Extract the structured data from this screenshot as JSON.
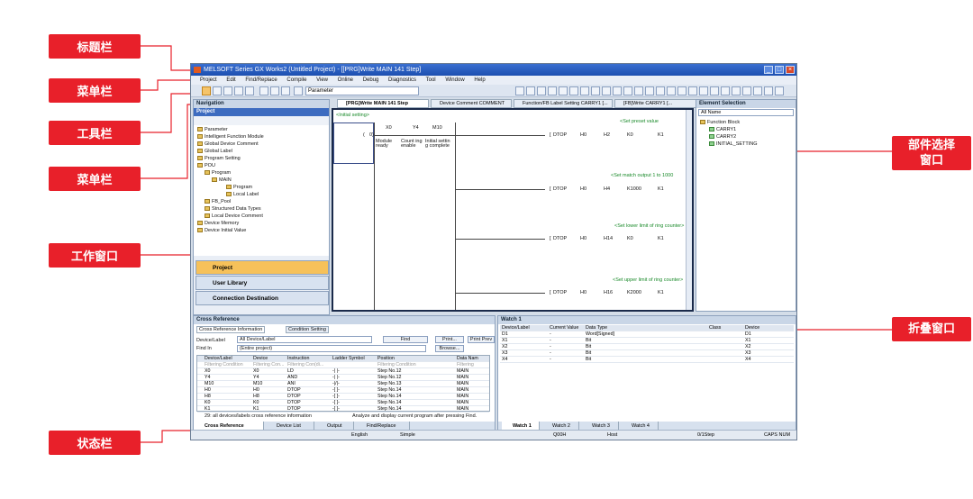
{
  "annotations": {
    "title_bar": "标题栏",
    "menu_bar_1": "菜单栏",
    "toolbar": "工具栏",
    "menu_bar_2": "菜单栏",
    "work_window": "工作窗口",
    "status_bar": "状态栏",
    "element_selection": "部件选择窗口",
    "collapse_window": "折叠窗口"
  },
  "window": {
    "title": "MELSOFT Series GX Works2 (Untitled Project) - [[PRG]Write MAIN 141 Step]",
    "menu": [
      "Project",
      "Edit",
      "Find/Replace",
      "Compile",
      "View",
      "Online",
      "Debug",
      "Diagnostics",
      "Tool",
      "Window",
      "Help"
    ],
    "toolbar_select": "Parameter"
  },
  "navigation": {
    "title": "Navigation",
    "sub_title": "Project",
    "tree": [
      "Parameter",
      "Intelligent Function Module",
      "Global Device Comment",
      "Global Label",
      "Program Setting",
      "POU",
      "Program",
      "MAIN",
      "Program",
      "Local Label",
      "FB_Pool",
      "Structured Data Types",
      "Local Device Comment",
      "Device Memory",
      "Device Initial Value"
    ],
    "buttons": [
      "Project",
      "User Library",
      "Connection Destination"
    ]
  },
  "tabs": [
    "[PRG]Write MAIN 141 Step",
    "Device Comment COMMENT",
    "Function/FB Label Setting CARRY1 [...",
    "[FB]Write CARRY1 [..."
  ],
  "ladder": {
    "header": "<Initial setting>",
    "contacts": [
      "X0",
      "Y4",
      "M10"
    ],
    "contact_comments": [
      "Module ready",
      "Count ing enable",
      "Initial settin g complete"
    ],
    "comments": [
      "<Set preset value",
      "<Set match output 1 to 1000",
      "<Set lower limit of ring counter>",
      "<Set upper limit of ring counter>"
    ],
    "rungs": [
      {
        "instr": "DTOP",
        "a": "H0",
        "b": "H2",
        "c": "K0",
        "d": "K1"
      },
      {
        "instr": "DTOP",
        "a": "H0",
        "b": "H4",
        "c": "K1000",
        "d": "K1"
      },
      {
        "instr": "DTOP",
        "a": "H0",
        "b": "H14",
        "c": "K0",
        "d": "K1"
      },
      {
        "instr": "DTOP",
        "a": "H0",
        "b": "H16",
        "c": "K2000",
        "d": "K1"
      }
    ]
  },
  "element_selection": {
    "title": "Element Selection",
    "select": "All Name",
    "tree": [
      "Function Block",
      "CARRY1",
      "CARRY2",
      "INITIAL_SETTING"
    ]
  },
  "cross_reference": {
    "title": "Cross Reference",
    "tab1": "Cross Reference Information",
    "tab2": "Condition Setting",
    "device_label": "Device/Label",
    "device_value": "All Device/Label",
    "find_in": "Find In",
    "find_value": "(Entire project)",
    "find_btn": "Find",
    "print_btn": "Print...",
    "print_prev": "Print Prev",
    "browse_btn": "Browse...",
    "columns": [
      "Device/Label",
      "Device",
      "Instruction",
      "Ladder Symbol",
      "Position",
      "Data Nam"
    ],
    "filter": [
      "Filtering Condition",
      "Filtering Con...",
      "Filtering Con(di...",
      "",
      "Filtering Condition",
      "Filtering"
    ],
    "rows": [
      [
        "X0",
        "X0",
        "LD",
        "-| |-",
        "Step No.12",
        "MAIN"
      ],
      [
        "Y4",
        "Y4",
        "AND",
        "-| |-",
        "Step No.12",
        "MAIN"
      ],
      [
        "M10",
        "M10",
        "ANI",
        "-|/|-",
        "Step No.13",
        "MAIN"
      ],
      [
        "H0",
        "H0",
        "DTOP",
        "-[ ]-",
        "Step No.14",
        "MAIN"
      ],
      [
        "H8",
        "H8",
        "DTOP",
        "-[ ]-",
        "Step No.14",
        "MAIN"
      ],
      [
        "K0",
        "K0",
        "DTOP",
        "-[ ]-",
        "Step No.14",
        "MAIN"
      ],
      [
        "K1",
        "K1",
        "DTOP",
        "-[ ]-",
        "Step No.14",
        "MAIN"
      ]
    ],
    "status_left": "29: all devices/labels cross reference information",
    "status_right": "Analyze and display current program after pressing Find.",
    "bottom_tabs": [
      "Cross Reference",
      "Device List",
      "Output",
      "Find/Replace"
    ]
  },
  "watch": {
    "title": "Watch 1",
    "columns": [
      "Device/Label",
      "Current Value",
      "Data Type",
      "Class",
      "Device"
    ],
    "rows": [
      [
        "D1",
        "-",
        "Word[Signed]",
        "",
        "D1"
      ],
      [
        "X1",
        "-",
        "Bit",
        "",
        "X1"
      ],
      [
        "X2",
        "-",
        "Bit",
        "",
        "X2"
      ],
      [
        "X3",
        "-",
        "Bit",
        "",
        "X3"
      ],
      [
        "X4",
        "-",
        "Bit",
        "",
        "X4"
      ]
    ],
    "bottom_tabs": [
      "Watch 1",
      "Watch 2",
      "Watch 3",
      "Watch 4"
    ]
  },
  "status": [
    "English",
    "Simple",
    "Q00H",
    "Host",
    "0/1Step",
    "CAPS NUM"
  ]
}
